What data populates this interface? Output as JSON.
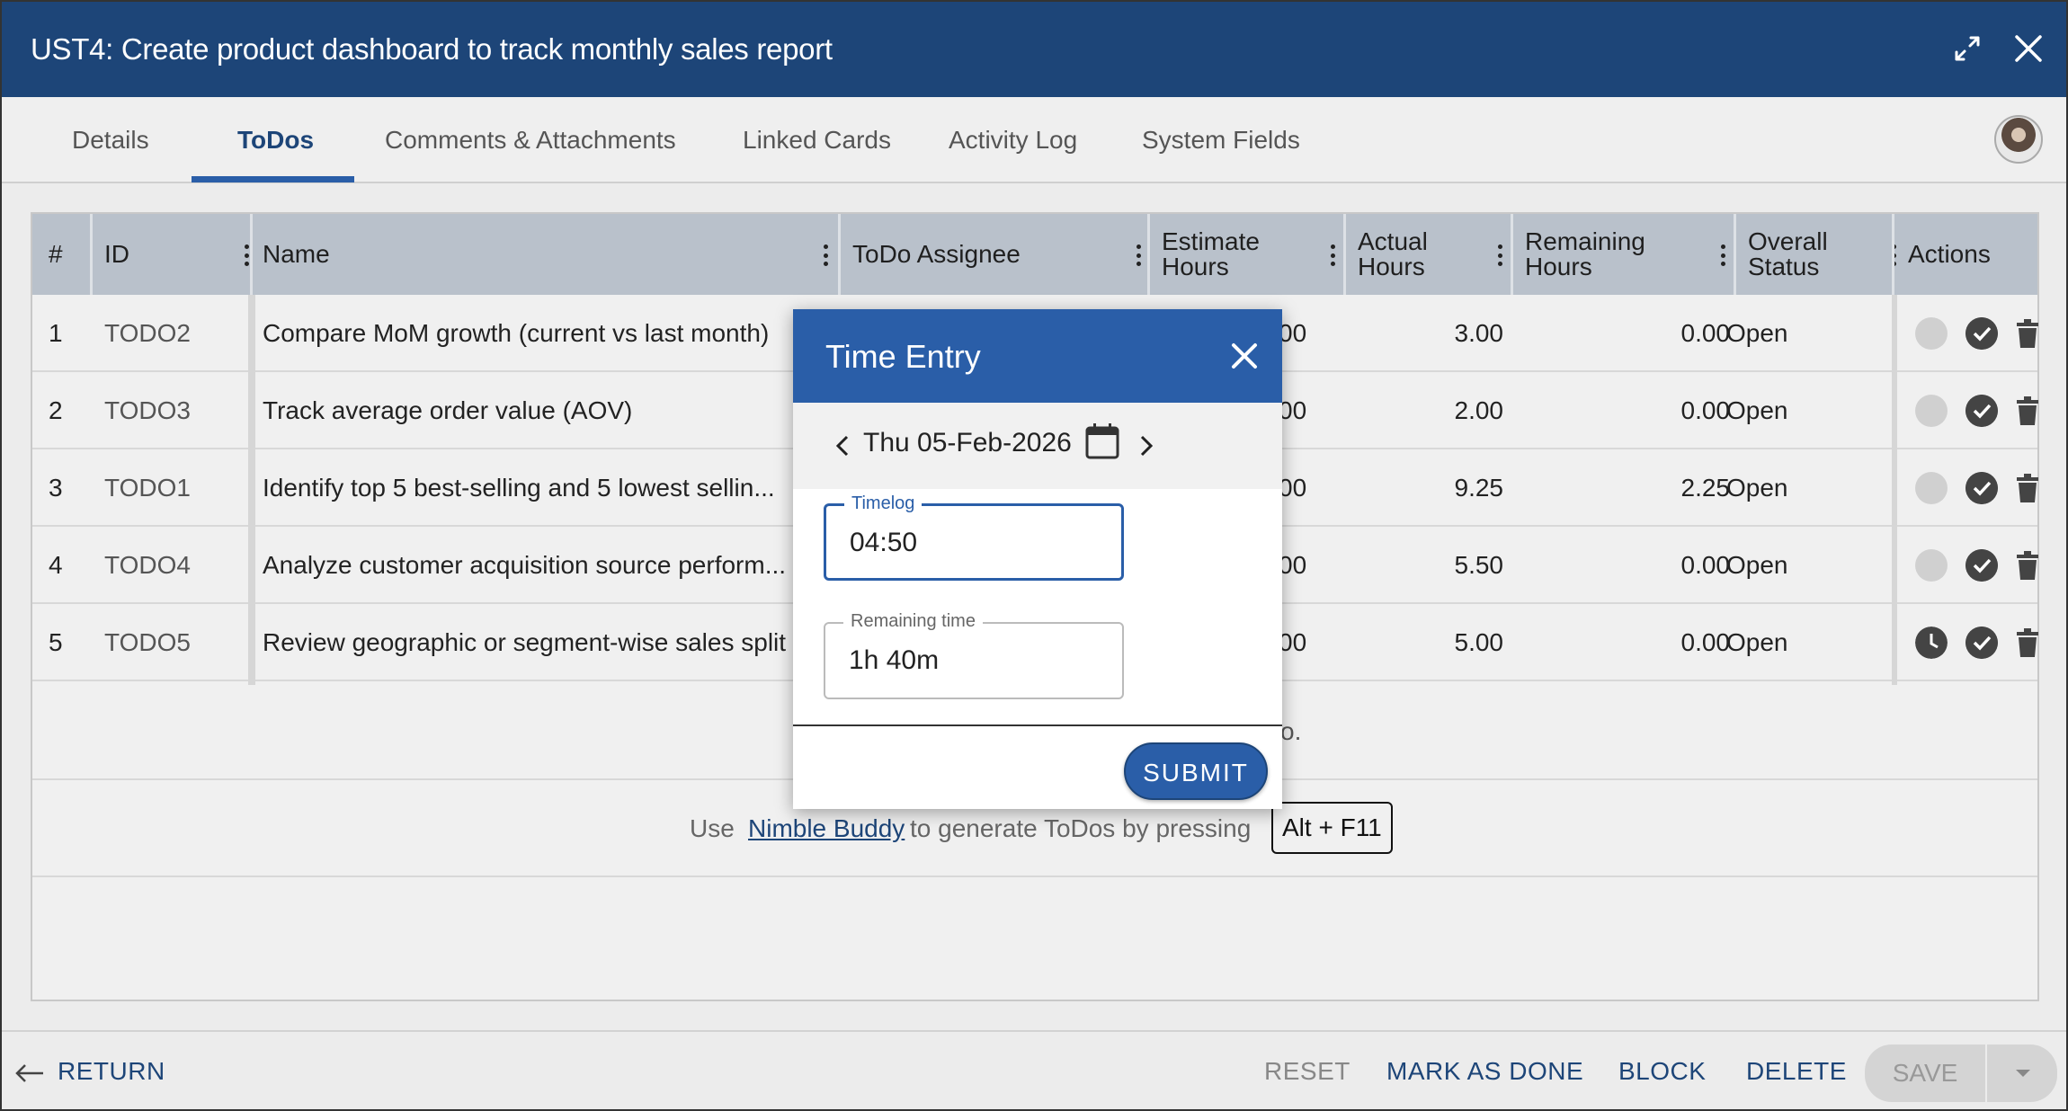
{
  "window": {
    "title": "UST4: Create product dashboard to track monthly sales report",
    "expand_icon": "expand-icon",
    "close_icon": "close-icon"
  },
  "tabs": [
    {
      "label": "Details"
    },
    {
      "label": "ToDos",
      "active": true
    },
    {
      "label": "Comments & Attachments"
    },
    {
      "label": "Linked Cards"
    },
    {
      "label": "Activity Log"
    },
    {
      "label": "System Fields"
    }
  ],
  "table": {
    "headers": {
      "num": "#",
      "id": "ID",
      "name": "Name",
      "assignee": "ToDo Assignee",
      "estimate_1": "Estimate",
      "estimate_2": "Hours",
      "actual_1": "Actual",
      "actual_2": "Hours",
      "remaining_1": "Remaining",
      "remaining_2": "Hours",
      "status_1": "Overall",
      "status_2": "Status",
      "actions": "Actions"
    },
    "rows": [
      {
        "num": "1",
        "id": "TODO2",
        "name": "Compare MoM growth (current vs last month)",
        "estimate_tail": "00",
        "actual": "3.00",
        "remaining": "0.00",
        "status": "Open"
      },
      {
        "num": "2",
        "id": "TODO3",
        "name": "Track average order value (AOV)",
        "estimate_tail": "00",
        "actual": "2.00",
        "remaining": "0.00",
        "status": "Open"
      },
      {
        "num": "3",
        "id": "TODO1",
        "name": "Identify top 5 best-selling and 5 lowest sellin...",
        "estimate_tail": "00",
        "actual": "9.25",
        "remaining": "2.25",
        "status": "Open"
      },
      {
        "num": "4",
        "id": "TODO4",
        "name": "Analyze customer acquisition source perform...",
        "estimate_tail": "00",
        "actual": "5.50",
        "remaining": "0.00",
        "status": "Open"
      },
      {
        "num": "5",
        "id": "TODO5",
        "name": "Review geographic or segment-wise sales split",
        "estimate_tail": "00",
        "actual": "5.00",
        "remaining": "0.00",
        "status": "Open"
      }
    ],
    "add_row_tail": "o."
  },
  "hint": {
    "prefix": "Use",
    "link": "Nimble Buddy",
    "suffix": "to generate ToDos by pressing",
    "shortcut": "Alt + F11"
  },
  "footer": {
    "return": "RETURN",
    "reset": "RESET",
    "mark_done": "MARK AS DONE",
    "block": "BLOCK",
    "delete": "DELETE",
    "save": "SAVE"
  },
  "modal": {
    "title": "Time Entry",
    "date": "Thu 05-Feb-2026",
    "timelog_label": "Timelog",
    "timelog_value": "04:50",
    "remaining_label": "Remaining time",
    "remaining_value": "1h 40m",
    "submit": "SUBMIT"
  },
  "colors": {
    "header_bg": "#1d4578",
    "accent": "#2a5ea8",
    "table_header_bg": "#b9c1cb"
  }
}
